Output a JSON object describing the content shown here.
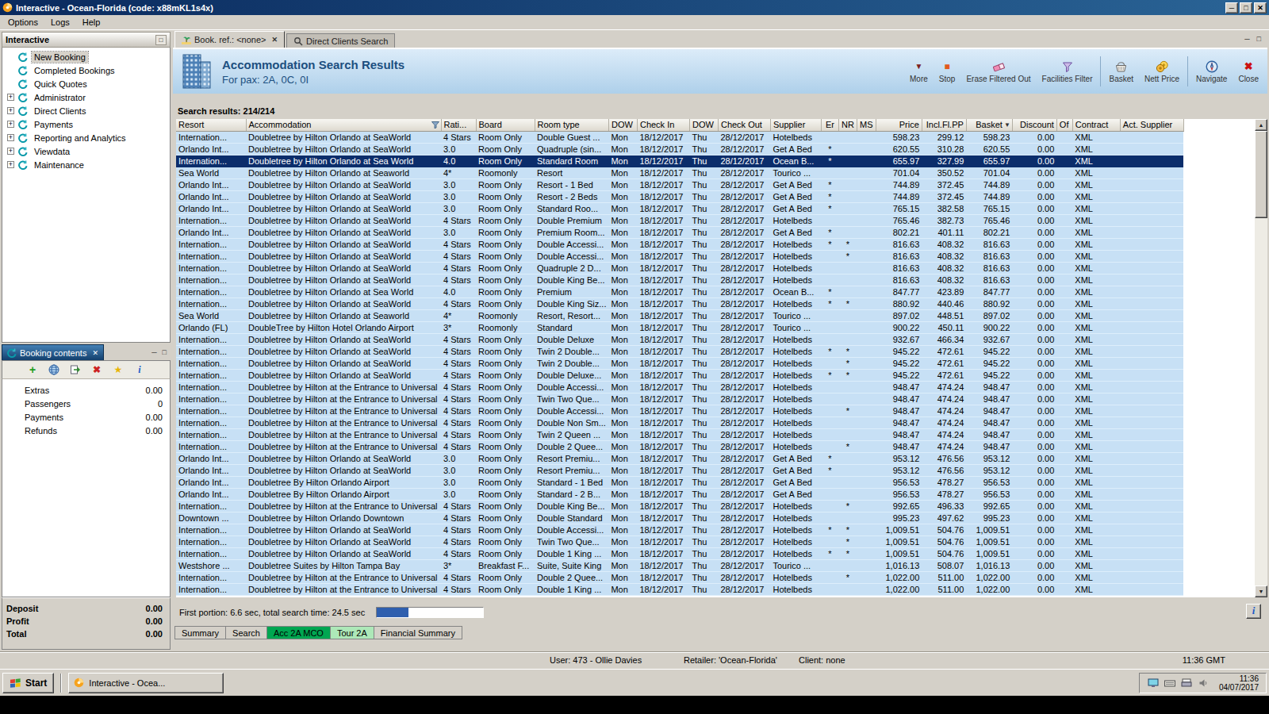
{
  "window": {
    "title": "Interactive - Ocean-Florida (code: x88mKL1s4x)",
    "menu": [
      "Options",
      "Logs",
      "Help"
    ]
  },
  "colors": {
    "titlebar": "#0a2a5e",
    "header_title": "#1c4f80",
    "row_band": "#c7e0f5",
    "selected_row": "#0b2d6b",
    "progress_fill": "#2f5fae"
  },
  "sidebar": {
    "title": "Interactive",
    "items": [
      {
        "label": "New Booking",
        "expandable": false,
        "selected": true
      },
      {
        "label": "Completed Bookings",
        "expandable": false
      },
      {
        "label": "Quick Quotes",
        "expandable": false
      },
      {
        "label": "Administrator",
        "expandable": true
      },
      {
        "label": "Direct Clients",
        "expandable": true
      },
      {
        "label": "Payments",
        "expandable": true
      },
      {
        "label": "Reporting and Analytics",
        "expandable": true
      },
      {
        "label": "Viewdata",
        "expandable": true
      },
      {
        "label": "Maintenance",
        "expandable": true
      }
    ]
  },
  "booking_contents": {
    "title": "Booking contents",
    "toolbar_icons": [
      "add-icon",
      "globe-icon",
      "import-icon",
      "delete-icon",
      "star-icon",
      "info-icon"
    ],
    "rows": [
      {
        "label": "Extras",
        "value": "0.00"
      },
      {
        "label": "Passengers",
        "value": "0"
      },
      {
        "label": "Payments",
        "value": "0.00"
      },
      {
        "label": "Refunds",
        "value": "0.00"
      }
    ],
    "totals": [
      {
        "label": "Deposit",
        "value": "0.00"
      },
      {
        "label": "Profit",
        "value": "0.00"
      },
      {
        "label": "Total",
        "value": "0.00"
      }
    ]
  },
  "tabs": [
    {
      "label": "Book. ref.: <none>",
      "icon": "palm-icon",
      "active": true,
      "closable": true
    },
    {
      "label": "Direct Clients Search",
      "icon": "search-icon",
      "active": false,
      "closable": false
    }
  ],
  "results_header": {
    "title": "Accommodation Search Results",
    "subtitle": "For pax: 2A, 0C, 0I",
    "toolbar_groups": [
      [
        {
          "label": "More",
          "icon": "chevron-down-icon"
        },
        {
          "label": "Stop",
          "icon": "stop-icon"
        },
        {
          "label": "Erase Filtered Out",
          "icon": "eraser-icon"
        },
        {
          "label": "Facilities Filter",
          "icon": "filter-icon"
        }
      ],
      [
        {
          "label": "Basket",
          "icon": "basket-icon"
        },
        {
          "label": "Nett Price",
          "icon": "coins-icon"
        }
      ],
      [
        {
          "label": "Navigate",
          "icon": "compass-icon"
        },
        {
          "label": "Close",
          "icon": "close-red-icon"
        }
      ]
    ]
  },
  "search_results_label": "Search results: 214/214",
  "table": {
    "columns": [
      "Resort",
      "Accommodation",
      "Rati...",
      "Board",
      "Room type",
      "DOW",
      "Check In",
      "DOW",
      "Check Out",
      "Supplier",
      "Er",
      "NR",
      "MS",
      "Price",
      "Incl.Fl.PP",
      "Basket",
      "Discount",
      "Of",
      "Contract",
      "Act. Supplier"
    ],
    "selected_row_index": 2,
    "rows": [
      [
        "Internation...",
        "Doubletree by Hilton Orlando at SeaWorld",
        "4 Stars",
        "Room Only",
        "Double Guest ...",
        "Mon",
        "18/12/2017",
        "Thu",
        "28/12/2017",
        "Hotelbeds",
        "",
        "",
        "",
        "598.23",
        "299.12",
        "598.23",
        "0.00",
        "",
        "XML",
        ""
      ],
      [
        "Orlando Int...",
        "Doubletree by Hilton Orlando at SeaWorld",
        "3.0",
        "Room Only",
        "Quadruple (sin...",
        "Mon",
        "18/12/2017",
        "Thu",
        "28/12/2017",
        "Get A Bed",
        "*",
        "",
        "",
        "620.55",
        "310.28",
        "620.55",
        "0.00",
        "",
        "XML",
        ""
      ],
      [
        "Internation...",
        "Doubletree by Hilton Orlando at Sea World",
        "4.0",
        "Room Only",
        "Standard Room",
        "Mon",
        "18/12/2017",
        "Thu",
        "28/12/2017",
        "Ocean B...",
        "*",
        "",
        "",
        "655.97",
        "327.99",
        "655.97",
        "0.00",
        "",
        "XML",
        ""
      ],
      [
        "Sea World",
        "Doubletree by Hilton Orlando at Seaworld",
        "4*",
        "Roomonly",
        "Resort",
        "Mon",
        "18/12/2017",
        "Thu",
        "28/12/2017",
        "Tourico ...",
        "",
        "",
        "",
        "701.04",
        "350.52",
        "701.04",
        "0.00",
        "",
        "XML",
        ""
      ],
      [
        "Orlando Int...",
        "Doubletree by Hilton Orlando at SeaWorld",
        "3.0",
        "Room Only",
        "Resort - 1 Bed",
        "Mon",
        "18/12/2017",
        "Thu",
        "28/12/2017",
        "Get A Bed",
        "*",
        "",
        "",
        "744.89",
        "372.45",
        "744.89",
        "0.00",
        "",
        "XML",
        ""
      ],
      [
        "Orlando Int...",
        "Doubletree by Hilton Orlando at SeaWorld",
        "3.0",
        "Room Only",
        "Resort - 2 Beds",
        "Mon",
        "18/12/2017",
        "Thu",
        "28/12/2017",
        "Get A Bed",
        "*",
        "",
        "",
        "744.89",
        "372.45",
        "744.89",
        "0.00",
        "",
        "XML",
        ""
      ],
      [
        "Orlando Int...",
        "Doubletree by Hilton Orlando at SeaWorld",
        "3.0",
        "Room Only",
        "Standard Roo...",
        "Mon",
        "18/12/2017",
        "Thu",
        "28/12/2017",
        "Get A Bed",
        "*",
        "",
        "",
        "765.15",
        "382.58",
        "765.15",
        "0.00",
        "",
        "XML",
        ""
      ],
      [
        "Internation...",
        "Doubletree by Hilton Orlando at SeaWorld",
        "4 Stars",
        "Room Only",
        "Double Premium",
        "Mon",
        "18/12/2017",
        "Thu",
        "28/12/2017",
        "Hotelbeds",
        "",
        "",
        "",
        "765.46",
        "382.73",
        "765.46",
        "0.00",
        "",
        "XML",
        ""
      ],
      [
        "Orlando Int...",
        "Doubletree by Hilton Orlando at SeaWorld",
        "3.0",
        "Room Only",
        "Premium Room...",
        "Mon",
        "18/12/2017",
        "Thu",
        "28/12/2017",
        "Get A Bed",
        "*",
        "",
        "",
        "802.21",
        "401.11",
        "802.21",
        "0.00",
        "",
        "XML",
        ""
      ],
      [
        "Internation...",
        "Doubletree by Hilton Orlando at SeaWorld",
        "4 Stars",
        "Room Only",
        "Double Accessi...",
        "Mon",
        "18/12/2017",
        "Thu",
        "28/12/2017",
        "Hotelbeds",
        "*",
        "*",
        "",
        "816.63",
        "408.32",
        "816.63",
        "0.00",
        "",
        "XML",
        ""
      ],
      [
        "Internation...",
        "Doubletree by Hilton Orlando at SeaWorld",
        "4 Stars",
        "Room Only",
        "Double Accessi...",
        "Mon",
        "18/12/2017",
        "Thu",
        "28/12/2017",
        "Hotelbeds",
        "",
        "*",
        "",
        "816.63",
        "408.32",
        "816.63",
        "0.00",
        "",
        "XML",
        ""
      ],
      [
        "Internation...",
        "Doubletree by Hilton Orlando at SeaWorld",
        "4 Stars",
        "Room Only",
        "Quadruple 2 D...",
        "Mon",
        "18/12/2017",
        "Thu",
        "28/12/2017",
        "Hotelbeds",
        "",
        "",
        "",
        "816.63",
        "408.32",
        "816.63",
        "0.00",
        "",
        "XML",
        ""
      ],
      [
        "Internation...",
        "Doubletree by Hilton Orlando at SeaWorld",
        "4 Stars",
        "Room Only",
        "Double King Be...",
        "Mon",
        "18/12/2017",
        "Thu",
        "28/12/2017",
        "Hotelbeds",
        "",
        "",
        "",
        "816.63",
        "408.32",
        "816.63",
        "0.00",
        "",
        "XML",
        ""
      ],
      [
        "Internation...",
        "Doubletree by Hilton Orlando at Sea World",
        "4.0",
        "Room Only",
        "Premium",
        "Mon",
        "18/12/2017",
        "Thu",
        "28/12/2017",
        "Ocean B...",
        "*",
        "",
        "",
        "847.77",
        "423.89",
        "847.77",
        "0.00",
        "",
        "XML",
        ""
      ],
      [
        "Internation...",
        "Doubletree by Hilton Orlando at SeaWorld",
        "4 Stars",
        "Room Only",
        "Double King Siz...",
        "Mon",
        "18/12/2017",
        "Thu",
        "28/12/2017",
        "Hotelbeds",
        "*",
        "*",
        "",
        "880.92",
        "440.46",
        "880.92",
        "0.00",
        "",
        "XML",
        ""
      ],
      [
        "Sea World",
        "Doubletree by Hilton Orlando at Seaworld",
        "4*",
        "Roomonly",
        "Resort, Resort...",
        "Mon",
        "18/12/2017",
        "Thu",
        "28/12/2017",
        "Tourico ...",
        "",
        "",
        "",
        "897.02",
        "448.51",
        "897.02",
        "0.00",
        "",
        "XML",
        ""
      ],
      [
        "Orlando (FL)",
        "DoubleTree by Hilton Hotel Orlando Airport",
        "3*",
        "Roomonly",
        "Standard",
        "Mon",
        "18/12/2017",
        "Thu",
        "28/12/2017",
        "Tourico ...",
        "",
        "",
        "",
        "900.22",
        "450.11",
        "900.22",
        "0.00",
        "",
        "XML",
        ""
      ],
      [
        "Internation...",
        "Doubletree by Hilton Orlando at SeaWorld",
        "4 Stars",
        "Room Only",
        "Double Deluxe",
        "Mon",
        "18/12/2017",
        "Thu",
        "28/12/2017",
        "Hotelbeds",
        "",
        "",
        "",
        "932.67",
        "466.34",
        "932.67",
        "0.00",
        "",
        "XML",
        ""
      ],
      [
        "Internation...",
        "Doubletree by Hilton Orlando at SeaWorld",
        "4 Stars",
        "Room Only",
        "Twin 2 Double...",
        "Mon",
        "18/12/2017",
        "Thu",
        "28/12/2017",
        "Hotelbeds",
        "*",
        "*",
        "",
        "945.22",
        "472.61",
        "945.22",
        "0.00",
        "",
        "XML",
        ""
      ],
      [
        "Internation...",
        "Doubletree by Hilton Orlando at SeaWorld",
        "4 Stars",
        "Room Only",
        "Twin 2 Double...",
        "Mon",
        "18/12/2017",
        "Thu",
        "28/12/2017",
        "Hotelbeds",
        "",
        "*",
        "",
        "945.22",
        "472.61",
        "945.22",
        "0.00",
        "",
        "XML",
        ""
      ],
      [
        "Internation...",
        "Doubletree by Hilton Orlando at SeaWorld",
        "4 Stars",
        "Room Only",
        "Double Deluxe...",
        "Mon",
        "18/12/2017",
        "Thu",
        "28/12/2017",
        "Hotelbeds",
        "*",
        "*",
        "",
        "945.22",
        "472.61",
        "945.22",
        "0.00",
        "",
        "XML",
        ""
      ],
      [
        "Internation...",
        "Doubletree by Hilton at the Entrance to Universal",
        "4 Stars",
        "Room Only",
        "Double Accessi...",
        "Mon",
        "18/12/2017",
        "Thu",
        "28/12/2017",
        "Hotelbeds",
        "",
        "",
        "",
        "948.47",
        "474.24",
        "948.47",
        "0.00",
        "",
        "XML",
        ""
      ],
      [
        "Internation...",
        "Doubletree by Hilton at the Entrance to Universal",
        "4 Stars",
        "Room Only",
        "Twin Two Que...",
        "Mon",
        "18/12/2017",
        "Thu",
        "28/12/2017",
        "Hotelbeds",
        "",
        "",
        "",
        "948.47",
        "474.24",
        "948.47",
        "0.00",
        "",
        "XML",
        ""
      ],
      [
        "Internation...",
        "Doubletree by Hilton at the Entrance to Universal",
        "4 Stars",
        "Room Only",
        "Double Accessi...",
        "Mon",
        "18/12/2017",
        "Thu",
        "28/12/2017",
        "Hotelbeds",
        "",
        "*",
        "",
        "948.47",
        "474.24",
        "948.47",
        "0.00",
        "",
        "XML",
        ""
      ],
      [
        "Internation...",
        "Doubletree by Hilton at the Entrance to Universal",
        "4 Stars",
        "Room Only",
        "Double Non Sm...",
        "Mon",
        "18/12/2017",
        "Thu",
        "28/12/2017",
        "Hotelbeds",
        "",
        "",
        "",
        "948.47",
        "474.24",
        "948.47",
        "0.00",
        "",
        "XML",
        ""
      ],
      [
        "Internation...",
        "Doubletree by Hilton at the Entrance to Universal",
        "4 Stars",
        "Room Only",
        "Twin 2 Queen ...",
        "Mon",
        "18/12/2017",
        "Thu",
        "28/12/2017",
        "Hotelbeds",
        "",
        "",
        "",
        "948.47",
        "474.24",
        "948.47",
        "0.00",
        "",
        "XML",
        ""
      ],
      [
        "Internation...",
        "Doubletree by Hilton at the Entrance to Universal",
        "4 Stars",
        "Room Only",
        "Double 2 Quee...",
        "Mon",
        "18/12/2017",
        "Thu",
        "28/12/2017",
        "Hotelbeds",
        "",
        "*",
        "",
        "948.47",
        "474.24",
        "948.47",
        "0.00",
        "",
        "XML",
        ""
      ],
      [
        "Orlando Int...",
        "Doubletree by Hilton Orlando at SeaWorld",
        "3.0",
        "Room Only",
        "Resort Premiu...",
        "Mon",
        "18/12/2017",
        "Thu",
        "28/12/2017",
        "Get A Bed",
        "*",
        "",
        "",
        "953.12",
        "476.56",
        "953.12",
        "0.00",
        "",
        "XML",
        ""
      ],
      [
        "Orlando Int...",
        "Doubletree by Hilton Orlando at SeaWorld",
        "3.0",
        "Room Only",
        "Resort Premiu...",
        "Mon",
        "18/12/2017",
        "Thu",
        "28/12/2017",
        "Get A Bed",
        "*",
        "",
        "",
        "953.12",
        "476.56",
        "953.12",
        "0.00",
        "",
        "XML",
        ""
      ],
      [
        "Orlando Int...",
        "Doubletree By Hilton Orlando Airport",
        "3.0",
        "Room Only",
        "Standard - 1 Bed",
        "Mon",
        "18/12/2017",
        "Thu",
        "28/12/2017",
        "Get A Bed",
        "",
        "",
        "",
        "956.53",
        "478.27",
        "956.53",
        "0.00",
        "",
        "XML",
        ""
      ],
      [
        "Orlando Int...",
        "Doubletree By Hilton Orlando Airport",
        "3.0",
        "Room Only",
        "Standard - 2 B...",
        "Mon",
        "18/12/2017",
        "Thu",
        "28/12/2017",
        "Get A Bed",
        "",
        "",
        "",
        "956.53",
        "478.27",
        "956.53",
        "0.00",
        "",
        "XML",
        ""
      ],
      [
        "Internation...",
        "Doubletree by Hilton at the Entrance to Universal",
        "4 Stars",
        "Room Only",
        "Double King Be...",
        "Mon",
        "18/12/2017",
        "Thu",
        "28/12/2017",
        "Hotelbeds",
        "",
        "*",
        "",
        "992.65",
        "496.33",
        "992.65",
        "0.00",
        "",
        "XML",
        ""
      ],
      [
        "Downtown ...",
        "Doubletree by Hilton Orlando Downtown",
        "4 Stars",
        "Room Only",
        "Double Standard",
        "Mon",
        "18/12/2017",
        "Thu",
        "28/12/2017",
        "Hotelbeds",
        "",
        "",
        "",
        "995.23",
        "497.62",
        "995.23",
        "0.00",
        "",
        "XML",
        ""
      ],
      [
        "Internation...",
        "Doubletree by Hilton Orlando at SeaWorld",
        "4 Stars",
        "Room Only",
        "Double Accessi...",
        "Mon",
        "18/12/2017",
        "Thu",
        "28/12/2017",
        "Hotelbeds",
        "*",
        "*",
        "",
        "1,009.51",
        "504.76",
        "1,009.51",
        "0.00",
        "",
        "XML",
        ""
      ],
      [
        "Internation...",
        "Doubletree by Hilton Orlando at SeaWorld",
        "4 Stars",
        "Room Only",
        "Twin Two Que...",
        "Mon",
        "18/12/2017",
        "Thu",
        "28/12/2017",
        "Hotelbeds",
        "",
        "*",
        "",
        "1,009.51",
        "504.76",
        "1,009.51",
        "0.00",
        "",
        "XML",
        ""
      ],
      [
        "Internation...",
        "Doubletree by Hilton Orlando at SeaWorld",
        "4 Stars",
        "Room Only",
        "Double 1 King ...",
        "Mon",
        "18/12/2017",
        "Thu",
        "28/12/2017",
        "Hotelbeds",
        "*",
        "*",
        "",
        "1,009.51",
        "504.76",
        "1,009.51",
        "0.00",
        "",
        "XML",
        ""
      ],
      [
        "Westshore ...",
        "Doubletree Suites by Hilton Tampa Bay",
        "3*",
        "Breakfast F...",
        "Suite, Suite King",
        "Mon",
        "18/12/2017",
        "Thu",
        "28/12/2017",
        "Tourico ...",
        "",
        "",
        "",
        "1,016.13",
        "508.07",
        "1,016.13",
        "0.00",
        "",
        "XML",
        ""
      ],
      [
        "Internation...",
        "Doubletree by Hilton at the Entrance to Universal",
        "4 Stars",
        "Room Only",
        "Double 2 Quee...",
        "Mon",
        "18/12/2017",
        "Thu",
        "28/12/2017",
        "Hotelbeds",
        "",
        "*",
        "",
        "1,022.00",
        "511.00",
        "1,022.00",
        "0.00",
        "",
        "XML",
        ""
      ],
      [
        "Internation...",
        "Doubletree by Hilton at the Entrance to Universal",
        "4 Stars",
        "Room Only",
        "Double 1 King ...",
        "Mon",
        "18/12/2017",
        "Thu",
        "28/12/2017",
        "Hotelbeds",
        "",
        "",
        "",
        "1,022.00",
        "511.00",
        "1,022.00",
        "0.00",
        "",
        "XML",
        ""
      ]
    ]
  },
  "status_strip": {
    "text": "First portion: 6.6 sec, total search time: 24.5 sec",
    "progress_percent": 30
  },
  "bottom_tabs": [
    {
      "label": "Summary"
    },
    {
      "label": "Search"
    },
    {
      "label": "Acc 2A MCO",
      "bg": "#00a651"
    },
    {
      "label": "Tour 2A",
      "bg": "#ade8b8"
    },
    {
      "label": "Financial Summary"
    }
  ],
  "status_bar": {
    "user": "User: 473 - Ollie Davies",
    "retailer": "Retailer: 'Ocean-Florida'",
    "client": "Client: none",
    "time": "11:36 GMT"
  },
  "taskbar": {
    "start_label": "Start",
    "task_label": "Interactive - Ocea...",
    "tray_icons": [
      "display-icon",
      "keyboard-icon",
      "print-icon",
      "volume-icon"
    ],
    "clock_time": "11:36",
    "clock_date": "04/07/2017"
  }
}
